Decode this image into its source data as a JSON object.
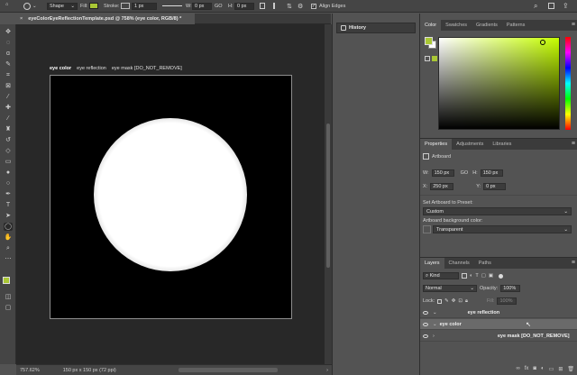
{
  "options_bar": {
    "mode": "Shape",
    "fill_label": "Fill:",
    "stroke_label": "Stroke:",
    "stroke_width": "1 px",
    "w_label": "W:",
    "w_value": "0 px",
    "link": "GO",
    "h_label": "H:",
    "h_value": "0 px",
    "align_edges": "Align Edges",
    "fill_color": "#a9c735"
  },
  "document": {
    "tab_title": "eyeColorEyeReflectionTemplate.psd @ 758% (eye color, RGB/8) *"
  },
  "canvas": {
    "artboard_labels": [
      "eye color",
      "eye reflection",
      "eye mask [DO_NOT_REMOVE]"
    ]
  },
  "status": {
    "zoom": "757.62%",
    "doc_size": "150 px x 150 px (72 ppi)"
  },
  "history_panel": {
    "title": "History"
  },
  "color_panel": {
    "tabs": [
      "Color",
      "Swatches",
      "Gradients",
      "Patterns"
    ],
    "foreground": "#a9c735",
    "background": "#ffffff"
  },
  "properties_panel": {
    "tabs": [
      "Properties",
      "Adjustments",
      "Libraries"
    ],
    "type": "Artboard",
    "w_label": "W:",
    "w_value": "150 px",
    "h_label": "H:",
    "h_value": "150 px",
    "link": "GO",
    "x_label": "X:",
    "x_value": "250 px",
    "y_label": "Y:",
    "y_value": "0 px",
    "preset_label": "Set Artboard to Preset:",
    "preset_value": "Custom",
    "bg_label": "Artboard background color:",
    "bg_value": "Transparent"
  },
  "layers_panel": {
    "tabs": [
      "Layers",
      "Channels",
      "Paths"
    ],
    "filter": "Kind",
    "blend_mode": "Normal",
    "opacity_label": "Opacity:",
    "opacity_value": "100%",
    "lock_label": "Lock:",
    "fill_label": "Fill:",
    "fill_value": "100%",
    "layers": [
      {
        "name": "eye reflection",
        "selected": false
      },
      {
        "name": "eye color",
        "selected": true
      },
      {
        "name": "eye mask [DO_NOT_REMOVE]",
        "selected": false
      }
    ]
  }
}
